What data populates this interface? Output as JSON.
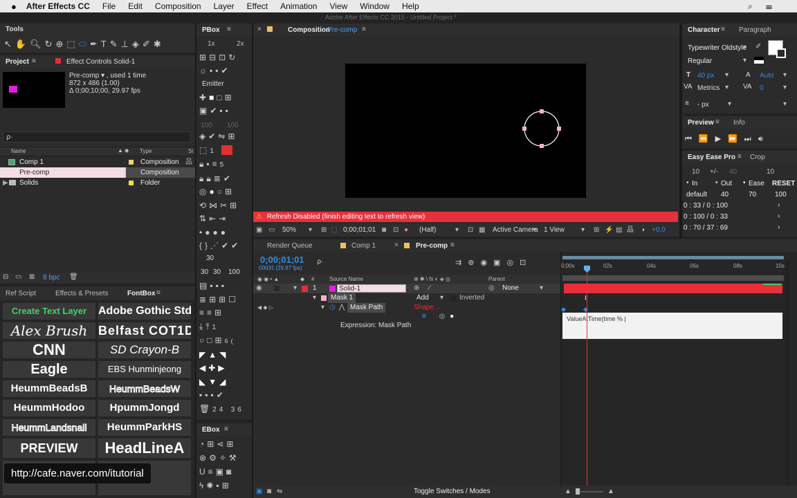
{
  "menubar": {
    "apple": "",
    "app": "After Effects CC",
    "items": [
      "File",
      "Edit",
      "Composition",
      "Layer",
      "Effect",
      "Animation",
      "View",
      "Window",
      "Help"
    ],
    "window_title": "Adobe After Effects CC 2015 - Untitled Project *"
  },
  "tools": {
    "title": "Tools"
  },
  "project": {
    "title": "Project",
    "effect_controls": "Effect Controls Solid-1",
    "item_name": "Pre-comp ▾ , used 1 time",
    "dimensions": "872 x 486 (1.00)",
    "duration": "Δ 0;00;10;00, 29.97 fps",
    "search_placeholder": "⍴·",
    "col_name": "Name",
    "col_type": "Type",
    "col_size": "Si",
    "items": [
      {
        "name": "Comp 1",
        "type": "Composition"
      },
      {
        "name": "Pre-comp",
        "type": "Composition"
      },
      {
        "name": "Solids",
        "type": "Folder"
      }
    ],
    "bpc": "8 bpc"
  },
  "pbox": {
    "title": "PBox",
    "zoom1": "1x",
    "zoom2": "2x",
    "emitter": "Emitter",
    "n100a": "100",
    "n100b": "100",
    "n1": "1",
    "n5": "5",
    "n30a": "30",
    "n30b": "30",
    "n30c": "30",
    "n100c": "100",
    "n1b": "1",
    "n6": "6(",
    "n24": "24",
    "n36": "36"
  },
  "ebox": {
    "title": "EBox"
  },
  "fontbox": {
    "tabs": [
      "Ref Script",
      "Effects & Presets",
      "FontBox"
    ],
    "fonts": [
      "Create Text Layer",
      "Adobe Gothic Std",
      "Alex Brush",
      "Belfast COT1D",
      "CNN",
      "SD Crayon-B",
      "Eagle",
      "EBS Hunminjeong",
      "HeummBeadsB",
      "HeummBeadsW",
      "HeummHodoo",
      "HpummJongd",
      "HeummLandsnail",
      "HeummParkHS",
      "PREVIEW",
      "HeadLineA"
    ],
    "watermark": "http://cafe.naver.com/itutorial"
  },
  "composition": {
    "tab": "Composition",
    "name": "Pre-comp",
    "warning": "Refresh Disabled (finish editing text to refresh view)",
    "zoom": "50%",
    "timecode": "0;00;01;01",
    "resolution": "(Half)",
    "camera": "Active Camera",
    "views": "1 View",
    "exposure": "+0.0"
  },
  "character": {
    "tabs": [
      "Character",
      "Paragraph"
    ],
    "font": "Typewriter Oldstyle",
    "style": "Regular",
    "size": "40 px",
    "leading": "Auto",
    "kerning": "Metrics",
    "tracking": "0",
    "unit": "- px"
  },
  "preview": {
    "tabs": [
      "Preview",
      "Info"
    ]
  },
  "easeease": {
    "tabs": [
      "Easy Ease Pro",
      "Crop"
    ],
    "v10a": "10",
    "pm": "+/-",
    "v40": "40",
    "v10b": "10",
    "in": "In",
    "out": "Out",
    "ease": "Ease",
    "reset": "RESET",
    "def": "default",
    "d40": "40",
    "d70": "70",
    "d100": "100",
    "r1": "0 : 33 / 0 : 100",
    "r2": "0 : 100 / 0 : 33",
    "r3": "0 : 70 / 37 : 69"
  },
  "timeline": {
    "tabs": [
      "Render Queue",
      "Comp 1",
      "Pre-comp"
    ],
    "timecode": "0;00;01;01",
    "frames": "00031 (29.97 fps)",
    "col_source": "Source Name",
    "col_parent": "Parent",
    "layer_num": "1",
    "layer_name": "Solid-1",
    "parent_val": "None",
    "mask": "Mask 1",
    "mask_mode": "Add",
    "inverted": "Inverted",
    "mask_path": "Mask Path",
    "shape": "Shape...",
    "expression_label": "Expression: Mask Path",
    "expression_text": "ValueAtTime(time % |",
    "ruler": [
      "0:00s",
      "02s",
      "04s",
      "06s",
      "08s",
      "10s"
    ],
    "toggle": "Toggle Switches / Modes"
  }
}
